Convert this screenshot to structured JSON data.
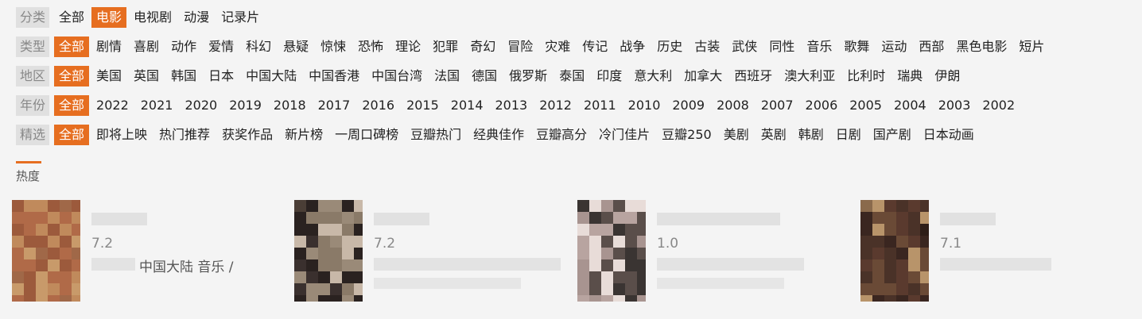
{
  "filters": [
    {
      "label": "分类",
      "options": [
        {
          "text": "全部",
          "active": false
        },
        {
          "text": "电影",
          "active": true
        },
        {
          "text": "电视剧",
          "active": false
        },
        {
          "text": "动漫",
          "active": false
        },
        {
          "text": "记录片",
          "active": false
        }
      ]
    },
    {
      "label": "类型",
      "options": [
        {
          "text": "全部",
          "active": true
        },
        {
          "text": "剧情"
        },
        {
          "text": "喜剧"
        },
        {
          "text": "动作"
        },
        {
          "text": "爱情"
        },
        {
          "text": "科幻"
        },
        {
          "text": "悬疑"
        },
        {
          "text": "惊悚"
        },
        {
          "text": "恐怖"
        },
        {
          "text": "理论"
        },
        {
          "text": "犯罪"
        },
        {
          "text": "奇幻"
        },
        {
          "text": "冒险"
        },
        {
          "text": "灾难"
        },
        {
          "text": "传记"
        },
        {
          "text": "战争"
        },
        {
          "text": "历史"
        },
        {
          "text": "古装"
        },
        {
          "text": "武侠"
        },
        {
          "text": "同性"
        },
        {
          "text": "音乐"
        },
        {
          "text": "歌舞"
        },
        {
          "text": "运动"
        },
        {
          "text": "西部"
        },
        {
          "text": "黑色电影"
        },
        {
          "text": "短片"
        }
      ]
    },
    {
      "label": "地区",
      "options": [
        {
          "text": "全部",
          "active": true
        },
        {
          "text": "美国"
        },
        {
          "text": "英国"
        },
        {
          "text": "韩国"
        },
        {
          "text": "日本"
        },
        {
          "text": "中国大陆"
        },
        {
          "text": "中国香港"
        },
        {
          "text": "中国台湾"
        },
        {
          "text": "法国"
        },
        {
          "text": "德国"
        },
        {
          "text": "俄罗斯"
        },
        {
          "text": "泰国"
        },
        {
          "text": "印度"
        },
        {
          "text": "意大利"
        },
        {
          "text": "加拿大"
        },
        {
          "text": "西班牙"
        },
        {
          "text": "澳大利亚"
        },
        {
          "text": "比利时"
        },
        {
          "text": "瑞典"
        },
        {
          "text": "伊朗"
        }
      ]
    },
    {
      "label": "年份",
      "options": [
        {
          "text": "全部",
          "active": true
        },
        {
          "text": "2022"
        },
        {
          "text": "2021"
        },
        {
          "text": "2020"
        },
        {
          "text": "2019"
        },
        {
          "text": "2018"
        },
        {
          "text": "2017"
        },
        {
          "text": "2016"
        },
        {
          "text": "2015"
        },
        {
          "text": "2014"
        },
        {
          "text": "2013"
        },
        {
          "text": "2012"
        },
        {
          "text": "2011"
        },
        {
          "text": "2010"
        },
        {
          "text": "2009"
        },
        {
          "text": "2008"
        },
        {
          "text": "2007"
        },
        {
          "text": "2006"
        },
        {
          "text": "2005"
        },
        {
          "text": "2004"
        },
        {
          "text": "2003"
        },
        {
          "text": "2002"
        }
      ]
    },
    {
      "label": "精选",
      "options": [
        {
          "text": "全部",
          "active": true
        },
        {
          "text": "即将上映"
        },
        {
          "text": "热门推荐"
        },
        {
          "text": "获奖作品"
        },
        {
          "text": "新片榜"
        },
        {
          "text": "一周口碑榜"
        },
        {
          "text": "豆瓣热门"
        },
        {
          "text": "经典佳作"
        },
        {
          "text": "豆瓣高分"
        },
        {
          "text": "冷门佳片"
        },
        {
          "text": "豆瓣250"
        },
        {
          "text": "美剧"
        },
        {
          "text": "英剧"
        },
        {
          "text": "韩剧"
        },
        {
          "text": "日剧"
        },
        {
          "text": "国产剧"
        },
        {
          "text": "日本动画"
        }
      ]
    }
  ],
  "sort": {
    "label": "热度"
  },
  "cards": [
    {
      "score": "7.2",
      "meta": "中国大陆 音乐 /"
    },
    {
      "score": "7.2",
      "meta": ""
    },
    {
      "score": "1.0",
      "meta": ""
    },
    {
      "score": "7.1",
      "meta": ""
    }
  ],
  "colors": {
    "accent": "#e66e20"
  }
}
